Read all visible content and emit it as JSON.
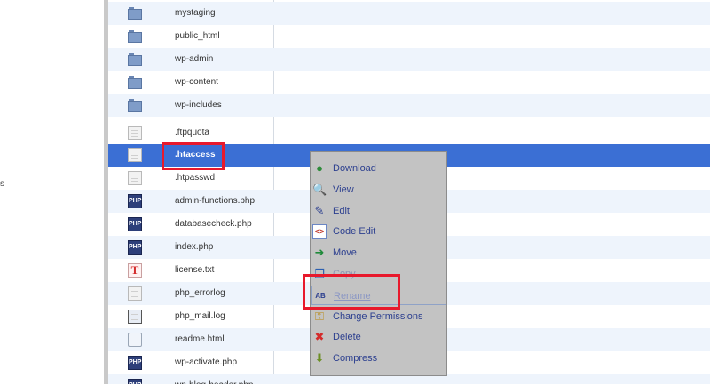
{
  "stray_text": "s",
  "files": [
    {
      "name": "mystaging",
      "type": "folder"
    },
    {
      "name": "public_html",
      "type": "folder"
    },
    {
      "name": "wp-admin",
      "type": "folder"
    },
    {
      "name": "wp-content",
      "type": "folder"
    },
    {
      "name": "wp-includes",
      "type": "folder"
    },
    {
      "name": ".ftpquota",
      "type": "file"
    },
    {
      "name": ".htaccess",
      "type": "file",
      "selected": true
    },
    {
      "name": ".htpasswd",
      "type": "file"
    },
    {
      "name": "admin-functions.php",
      "type": "php"
    },
    {
      "name": "databasecheck.php",
      "type": "php"
    },
    {
      "name": "index.php",
      "type": "php"
    },
    {
      "name": "license.txt",
      "type": "txt"
    },
    {
      "name": "php_errorlog",
      "type": "file"
    },
    {
      "name": "php_mail.log",
      "type": "log"
    },
    {
      "name": "readme.html",
      "type": "html"
    },
    {
      "name": "wp-activate.php",
      "type": "php"
    },
    {
      "name": "wp-blog-header.php",
      "type": "php"
    }
  ],
  "php_icon_text": "PHP",
  "txt_icon_text": "T",
  "context_menu": {
    "items": [
      {
        "label": "Download",
        "icon": "globe-download-icon",
        "glyph": "●",
        "color": "#2e8b3a"
      },
      {
        "label": "View",
        "icon": "magnifier-icon",
        "glyph": "🔍",
        "color": "#3a5fb0"
      },
      {
        "label": "Edit",
        "icon": "pencil-icon",
        "glyph": "✎",
        "color": "#2c3f8f"
      },
      {
        "label": "Code Edit",
        "icon": "code-edit-icon",
        "glyph": "<>",
        "color": "#c0392b"
      },
      {
        "label": "Move",
        "icon": "move-arrow-icon",
        "glyph": "➜",
        "color": "#1f8a3a"
      },
      {
        "label": "Copy",
        "icon": "copy-icon",
        "glyph": "❐",
        "color": "#2c5fb0"
      },
      {
        "label": "Rename",
        "icon": "rename-ab-icon",
        "glyph": "AB",
        "color": "#2c3f8f"
      },
      {
        "label": "Change Permissions",
        "icon": "key-icon",
        "glyph": "⚿",
        "color": "#b8860b"
      },
      {
        "label": "Delete",
        "icon": "red-x-icon",
        "glyph": "✖",
        "color": "#d42b2b"
      },
      {
        "label": "Compress",
        "icon": "compress-icon",
        "glyph": "⬇",
        "color": "#6b8e23"
      }
    ]
  },
  "highlight_color": "#e8192c"
}
